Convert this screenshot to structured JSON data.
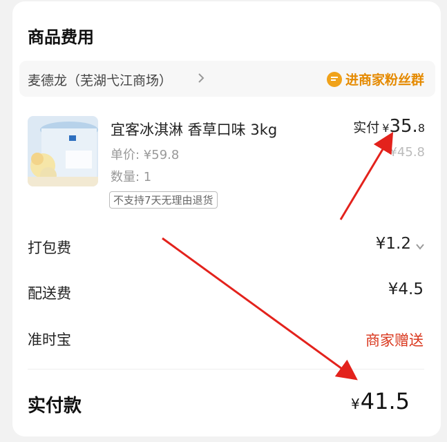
{
  "section": {
    "title": "商品费用"
  },
  "store": {
    "name": "麦德龙（芜湖弋江商场）",
    "fans_group": "进商家粉丝群"
  },
  "product": {
    "name": "宜客冰淇淋 香草口味 3kg",
    "unit_price": "单价: ¥59.8",
    "quantity": "数量: 1",
    "tag": "不支持7天无理由退货",
    "paid_label": "实付",
    "paid_yen": "¥",
    "paid_int": "35.",
    "paid_dec": "8",
    "original_price": "¥45.8"
  },
  "fees": {
    "packing": {
      "label": "打包费",
      "value": "¥1.2"
    },
    "delivery": {
      "label": "配送费",
      "value": "¥4.5"
    },
    "ontime": {
      "label": "准时宝",
      "value": "商家赠送"
    }
  },
  "total": {
    "label": "实付款",
    "yen": "¥",
    "amount": "41.5"
  },
  "colors": {
    "accent_orange": "#e58a00",
    "red_text": "#d9361c",
    "arrow_red": "#e3221c"
  },
  "icons": {
    "fans": "chat-bubble-icon",
    "store_link": "chevron-right-icon",
    "packing_expand": "chevron-down-icon"
  }
}
